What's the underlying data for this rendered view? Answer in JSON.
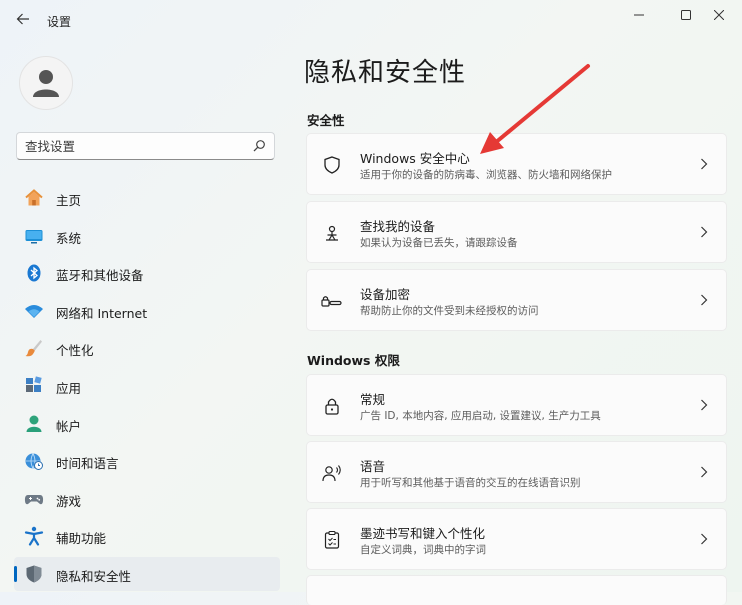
{
  "window": {
    "app_title": "设置",
    "back_icon": "arrow-left-icon",
    "controls": [
      "minimize-icon",
      "maximize-icon",
      "close-icon"
    ]
  },
  "sidebar": {
    "avatar_icon": "user-avatar-icon",
    "search": {
      "placeholder": "查找设置",
      "value": "",
      "icon": "search-icon"
    },
    "items": [
      {
        "label": "主页",
        "icon": "home-icon",
        "selected": false
      },
      {
        "label": "系统",
        "icon": "monitor-icon",
        "selected": false
      },
      {
        "label": "蓝牙和其他设备",
        "icon": "bluetooth-icon",
        "selected": false
      },
      {
        "label": "网络和 Internet",
        "icon": "wifi-icon",
        "selected": false
      },
      {
        "label": "个性化",
        "icon": "paintbrush-icon",
        "selected": false
      },
      {
        "label": "应用",
        "icon": "apps-icon",
        "selected": false
      },
      {
        "label": "帐户",
        "icon": "account-icon",
        "selected": false
      },
      {
        "label": "时间和语言",
        "icon": "globe-clock-icon",
        "selected": false
      },
      {
        "label": "游戏",
        "icon": "gamepad-icon",
        "selected": false
      },
      {
        "label": "辅助功能",
        "icon": "accessibility-icon",
        "selected": false
      },
      {
        "label": "隐私和安全性",
        "icon": "shield-icon",
        "selected": true
      }
    ]
  },
  "main": {
    "page_title": "隐私和安全性",
    "sections": [
      {
        "title": "安全性",
        "cards": [
          {
            "title": "Windows 安全中心",
            "subtitle": "适用于你的设备的防病毒、浏览器、防火墙和网络保护",
            "icon": "shield-outline-icon"
          },
          {
            "title": "查找我的设备",
            "subtitle": "如果认为设备已丢失，请跟踪设备",
            "icon": "find-device-icon"
          },
          {
            "title": "设备加密",
            "subtitle": "帮助防止你的文件受到未经授权的访问",
            "icon": "key-encryption-icon"
          }
        ]
      },
      {
        "title": "Windows 权限",
        "cards": [
          {
            "title": "常规",
            "subtitle": "广告 ID, 本地内容, 应用启动, 设置建议, 生产力工具",
            "icon": "lock-icon"
          },
          {
            "title": "语音",
            "subtitle": "用于听写和其他基于语音的交互的在线语音识别",
            "icon": "speech-icon"
          },
          {
            "title": "墨迹书写和键入个性化",
            "subtitle": "自定义词典，词典中的字词",
            "icon": "clipboard-ink-icon"
          }
        ]
      }
    ]
  },
  "colors": {
    "accent": "#0067c0",
    "annotation_arrow": "#e53935",
    "card_bg": "#fbfbfb",
    "selected_bg": "#e8ecef"
  }
}
